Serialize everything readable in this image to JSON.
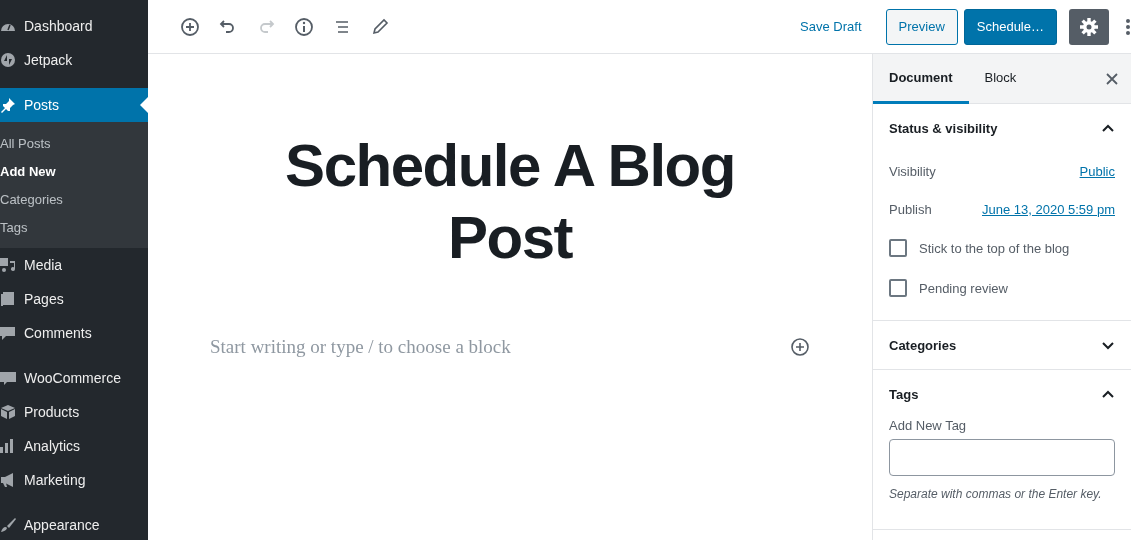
{
  "sidebar": {
    "groups": [
      {
        "items": [
          {
            "label": "Dashboard",
            "selected": false
          },
          {
            "label": "Jetpack",
            "selected": false
          }
        ]
      },
      {
        "items": [
          {
            "label": "Posts",
            "selected": true,
            "children": [
              {
                "label": "All Posts",
                "selected": false
              },
              {
                "label": "Add New",
                "selected": true
              },
              {
                "label": "Categories",
                "selected": false
              },
              {
                "label": "Tags",
                "selected": false
              }
            ]
          },
          {
            "label": "Media",
            "selected": false
          },
          {
            "label": "Pages",
            "selected": false
          },
          {
            "label": "Comments",
            "selected": false
          }
        ]
      },
      {
        "items": [
          {
            "label": "WooCommerce",
            "selected": false
          },
          {
            "label": "Products",
            "selected": false
          },
          {
            "label": "Analytics",
            "selected": false
          },
          {
            "label": "Marketing",
            "selected": false
          }
        ]
      },
      {
        "items": [
          {
            "label": "Appearance",
            "selected": false
          }
        ]
      }
    ]
  },
  "toolbar": {
    "tools": [
      {
        "kind": "add",
        "disabled": false
      },
      {
        "kind": "undo",
        "disabled": false
      },
      {
        "kind": "redo",
        "disabled": true
      },
      {
        "kind": "info",
        "disabled": false
      },
      {
        "kind": "outline",
        "disabled": false
      },
      {
        "kind": "edit",
        "disabled": false
      }
    ],
    "save_draft": "Save Draft",
    "preview": "Preview",
    "schedule": "Schedule…",
    "settings": {
      "pressed": true
    }
  },
  "editor": {
    "title": "Schedule A Blog Post",
    "placeholder": "Start writing or type / to choose a block"
  },
  "panel": {
    "tabs": [
      {
        "label": "Document",
        "selected": true
      },
      {
        "label": "Block",
        "selected": false
      }
    ],
    "sections": [
      {
        "kind": "status",
        "title": "Status & visibility",
        "expanded": true,
        "rows": [
          {
            "label": "Visibility",
            "value": "Public"
          },
          {
            "label": "Publish",
            "value": "June 13, 2020 5:59 pm"
          }
        ],
        "checks": [
          {
            "label": "Stick to the top of the blog",
            "checked": false
          },
          {
            "label": "Pending review",
            "checked": false
          }
        ]
      },
      {
        "title": "Categories",
        "expanded": false
      },
      {
        "kind": "tags",
        "title": "Tags",
        "expanded": true,
        "field_label": "Add New Tag",
        "help": "Separate with commas or the Enter key."
      }
    ]
  }
}
